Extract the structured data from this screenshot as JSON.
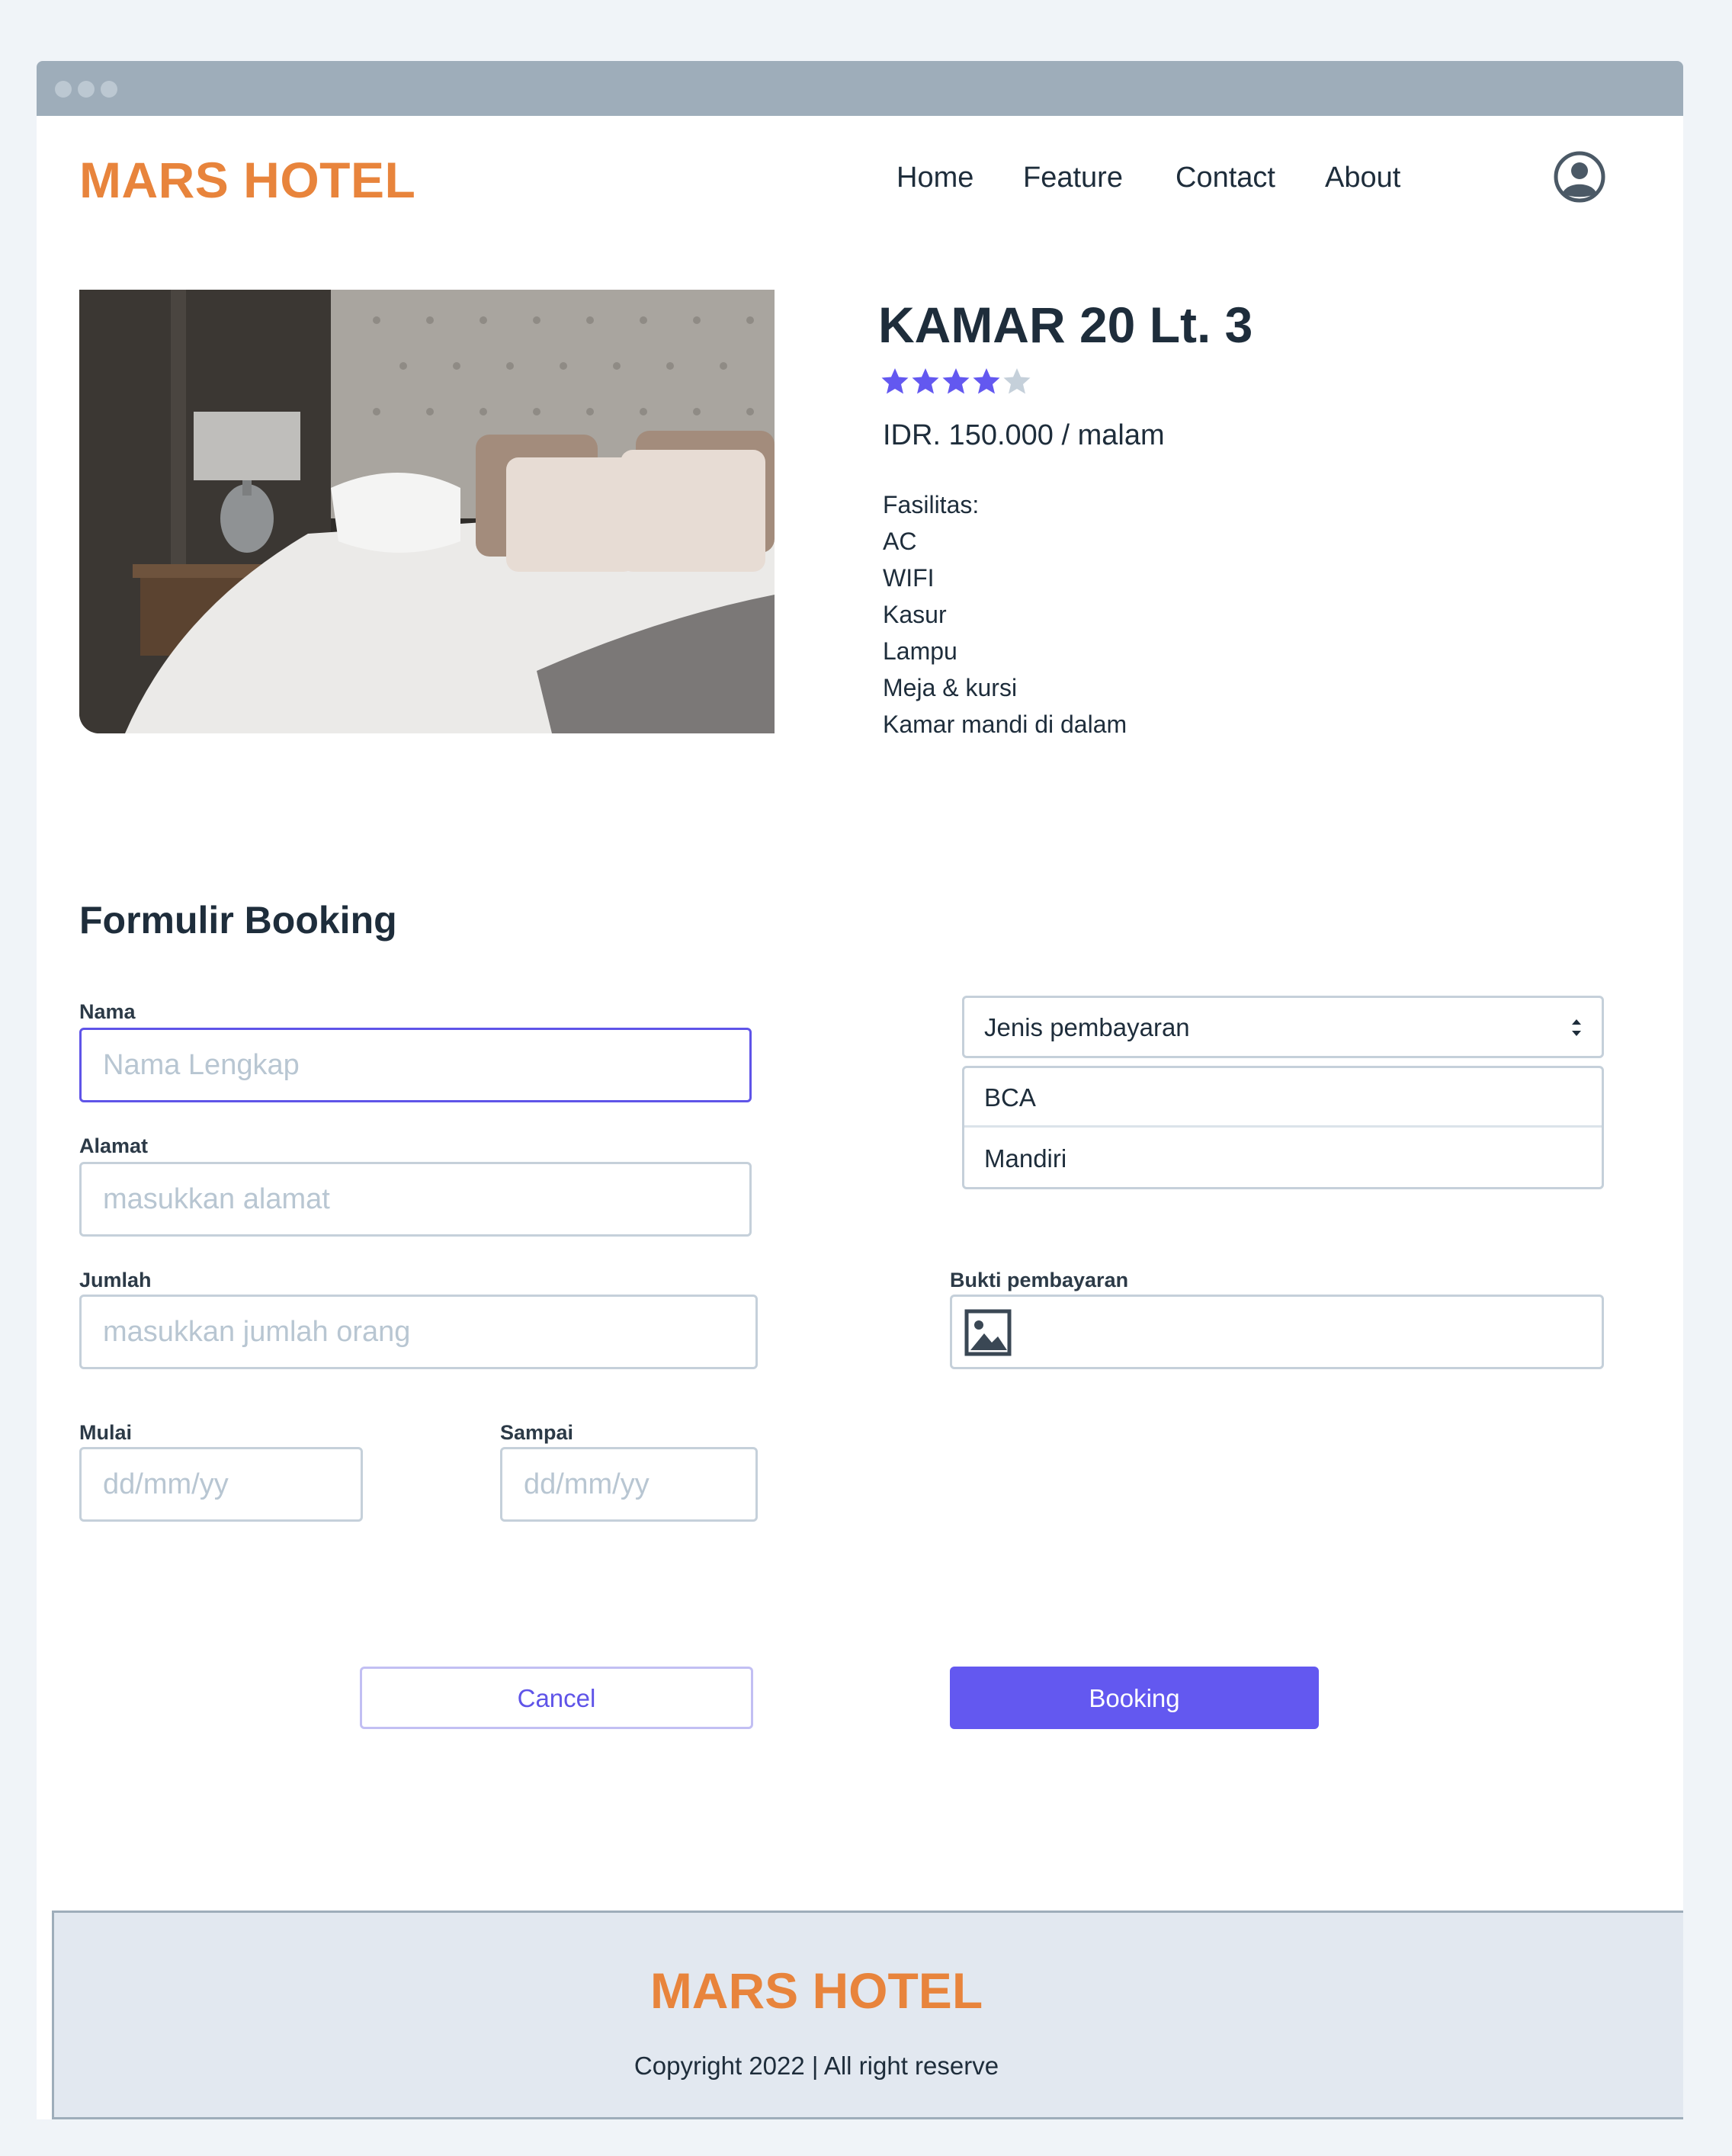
{
  "header": {
    "brand": "MARS HOTEL",
    "nav": [
      "Home",
      "Feature",
      "Contact",
      "About"
    ],
    "profile_icon": "user-circle-icon"
  },
  "room": {
    "image_icon": "hotel-bedroom-photo",
    "title": "KAMAR 20 Lt. 3",
    "rating": 4,
    "rating_max": 5,
    "star_color": "#6358f0",
    "star_empty_color": "#c5d0da",
    "price": "IDR. 150.000 / malam",
    "facilities_label": "Fasilitas:",
    "facilities": [
      "AC",
      "WIFI",
      "Kasur",
      "Lampu",
      "Meja & kursi",
      "Kamar mandi di dalam"
    ]
  },
  "form": {
    "title": "Formulir Booking",
    "nama": {
      "label": "Nama",
      "placeholder": "Nama Lengkap"
    },
    "alamat": {
      "label": "Alamat",
      "placeholder": "masukkan alamat"
    },
    "jumlah": {
      "label": "Jumlah",
      "placeholder": "masukkan jumlah orang"
    },
    "mulai": {
      "label": "Mulai",
      "placeholder": "dd/mm/yy"
    },
    "sampai": {
      "label": "Sampai",
      "placeholder": "dd/mm/yy"
    },
    "payment": {
      "selected": "Jenis pembayaran",
      "options": [
        "BCA",
        "Mandiri"
      ]
    },
    "bukti": {
      "label": "Bukti pembayaran",
      "icon": "image-icon"
    },
    "cancel_label": "Cancel",
    "booking_label": "Booking"
  },
  "footer": {
    "brand": "MARS HOTEL",
    "copyright": "Copyright 2022 | All right reserve"
  },
  "colors": {
    "brand": "#e8843c",
    "accent": "#6358f0",
    "text": "#1e2d3b"
  }
}
